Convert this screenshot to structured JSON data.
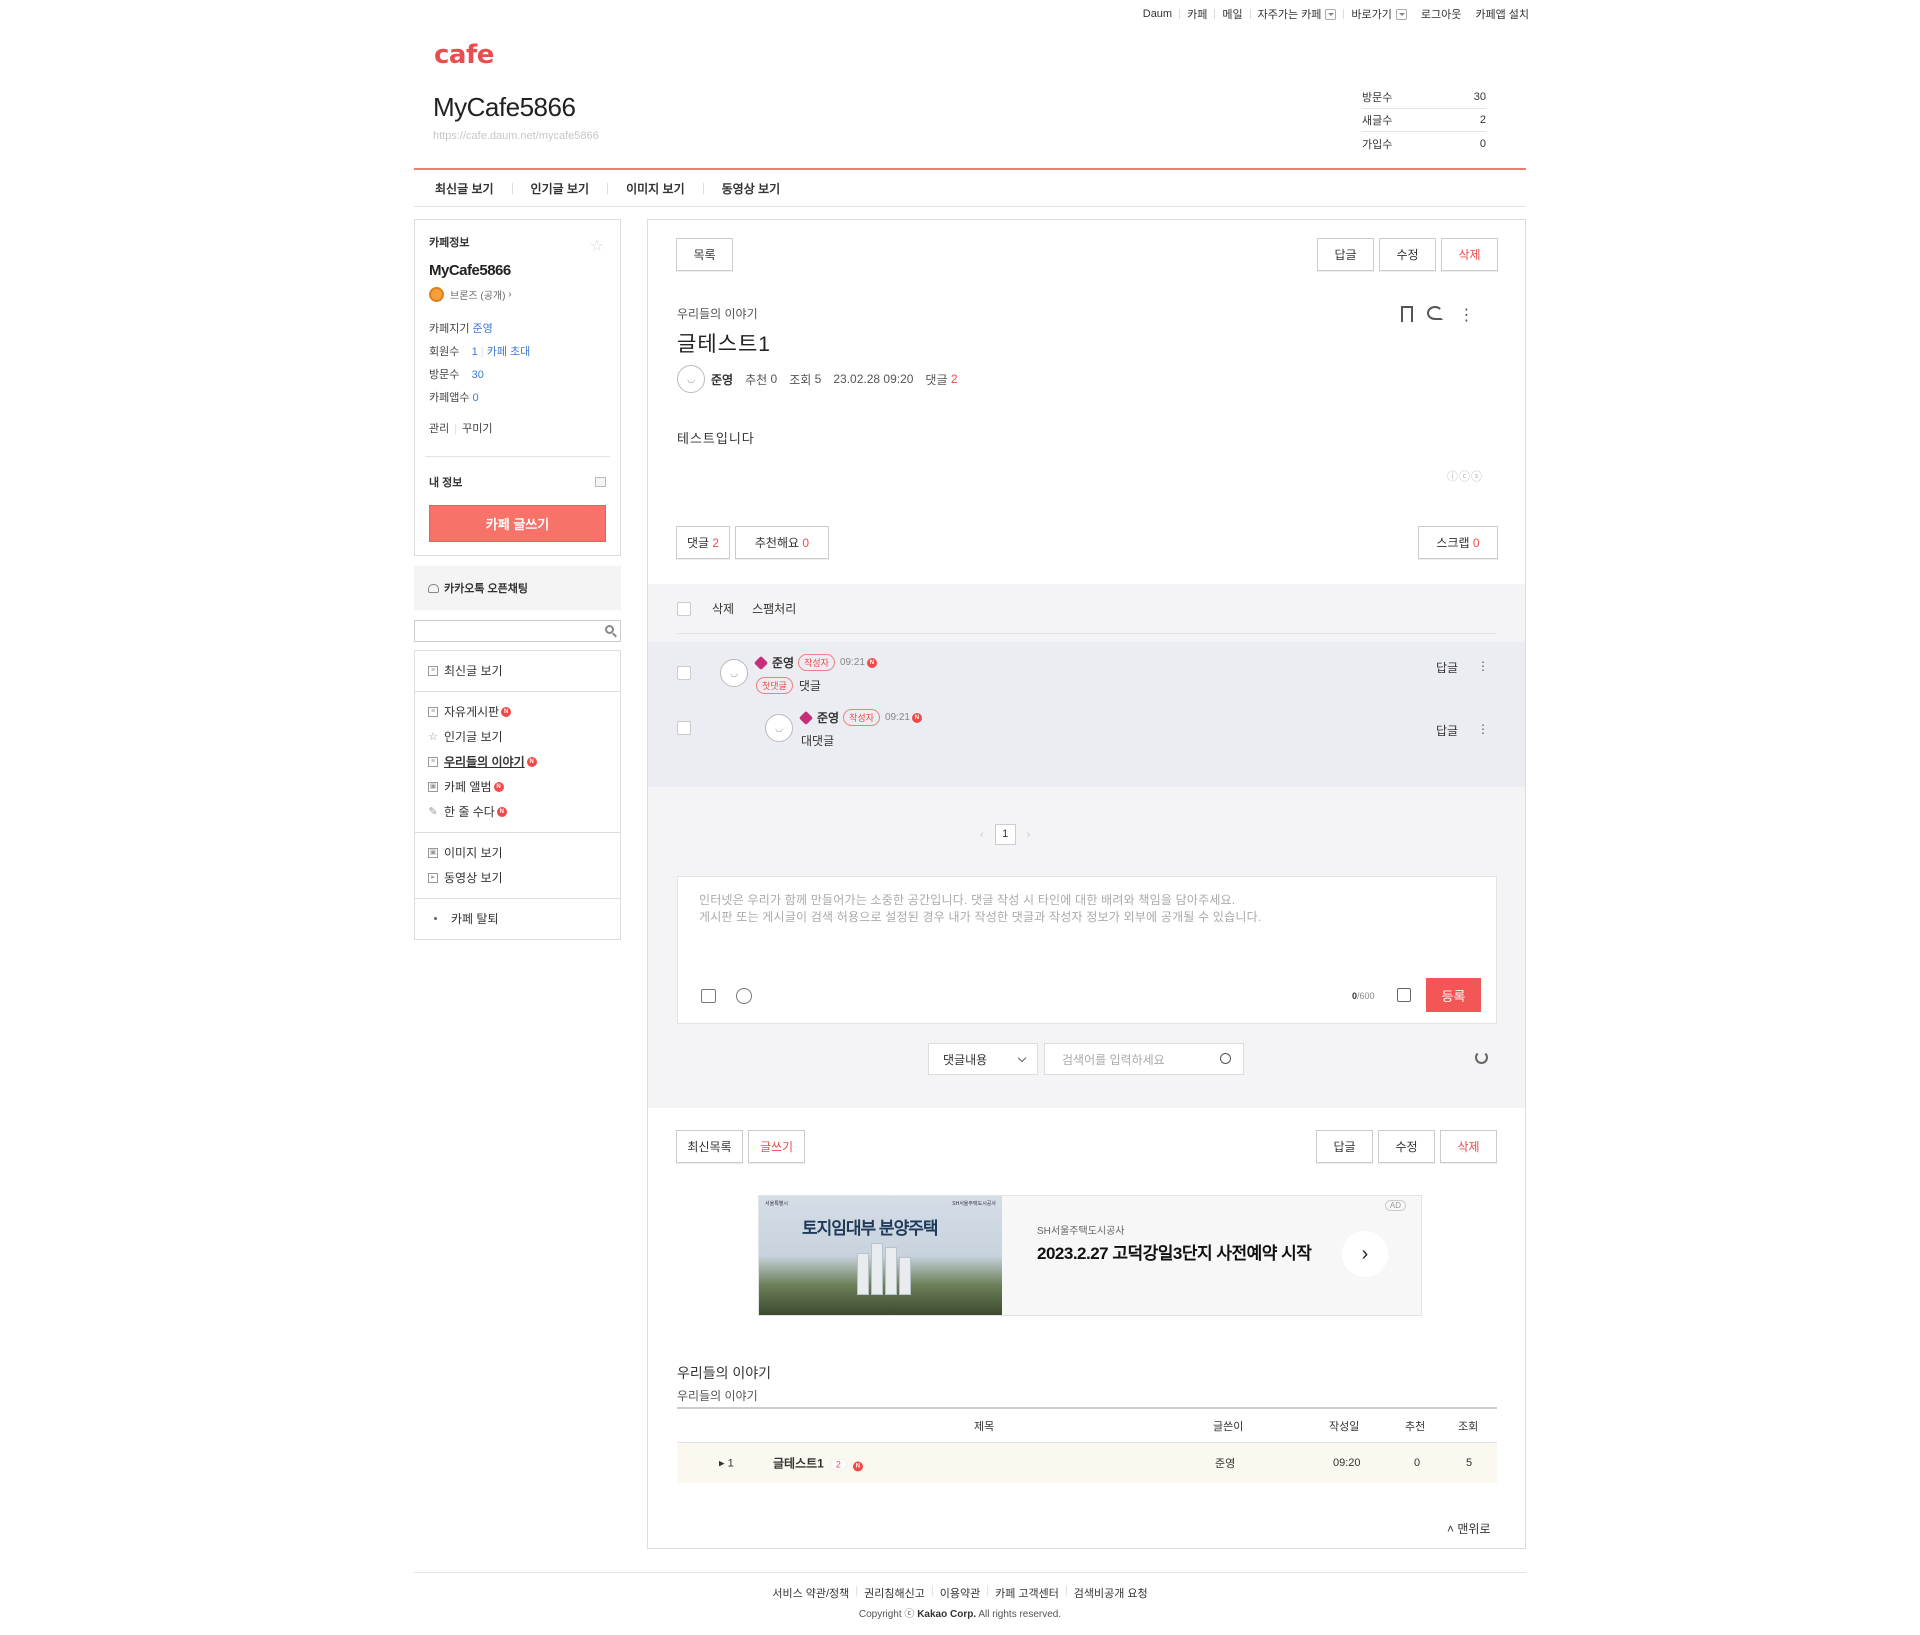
{
  "gnb": {
    "daum": "Daum",
    "cafe": "카페",
    "mail": "메일",
    "fav_cafe": "자주가는 카페",
    "shortcut": "바로가기",
    "logout": "로그아웃",
    "install_app": "카페앱 설치"
  },
  "header": {
    "logo": "cafe",
    "cafe_name": "MyCafe5866",
    "cafe_url": "https://cafe.daum.net/mycafe5866",
    "stats": [
      {
        "label": "방문수",
        "value": "30"
      },
      {
        "label": "새글수",
        "value": "2"
      },
      {
        "label": "가입수",
        "value": "0"
      }
    ]
  },
  "tabs": [
    "최신글 보기",
    "인기글 보기",
    "이미지 보기",
    "동영상 보기"
  ],
  "sidebar": {
    "info_heading": "카페정보",
    "cafe_name": "MyCafe5866",
    "grade": "브론즈 (공개)",
    "manager_label": "카페지기",
    "manager_value": "준영",
    "members_label": "회원수",
    "members_value": "1",
    "invite": "카페 초대",
    "visits_label": "방문수",
    "visits_value": "30",
    "app_label": "카페앱수",
    "app_value": "0",
    "admin": "관리",
    "decorate": "꾸미기",
    "my_info": "내 정보",
    "write_button": "카페 글쓰기",
    "kakao": "카카오톡 오픈채팅",
    "menu_groups": [
      [
        {
          "label": "최신글 보기",
          "icon": "list-icon",
          "new": false
        }
      ],
      [
        {
          "label": "자유게시판",
          "icon": "board-icon",
          "new": true
        },
        {
          "label": "인기글 보기",
          "icon": "star-icon",
          "new": false
        },
        {
          "label": "우리들의 이야기",
          "icon": "board-icon",
          "new": true
        },
        {
          "label": "카페 앨범",
          "icon": "image-icon",
          "new": true
        },
        {
          "label": "한 줄 수다",
          "icon": "pencil-icon",
          "new": true
        }
      ],
      [
        {
          "label": "이미지 보기",
          "icon": "image-icon",
          "new": false
        },
        {
          "label": "동영상 보기",
          "icon": "video-icon",
          "new": false
        }
      ]
    ],
    "leave": "카페 탈퇴",
    "new_badge": "N"
  },
  "post": {
    "list_button": "목록",
    "reply_button": "답글",
    "edit_button": "수정",
    "delete_button": "삭제",
    "board_name": "우리들의 이야기",
    "title": "글테스트1",
    "author": "준영",
    "recommend_label": "추천",
    "recommend_value": "0",
    "views_label": "조회",
    "views_value": "5",
    "date": "23.02.28 09:20",
    "comments_label": "댓글",
    "comments_value": "2",
    "content": "테스트입니다",
    "ccl": "ⓘⓒⓢ",
    "comment_btn_label": "댓글",
    "comment_btn_value": "2",
    "like_btn_label": "추천해요",
    "like_btn_value": "0",
    "scrap_btn_label": "스크랩",
    "scrap_btn_value": "0"
  },
  "comments": {
    "delete": "삭제",
    "spam": "스팸처리",
    "author_tag": "작성자",
    "first_tag": "첫댓글",
    "reply": "답글",
    "items": [
      {
        "nick": "준영",
        "time": "09:21",
        "text": "댓글"
      },
      {
        "nick": "준영",
        "time": "09:21",
        "text": "대댓글"
      }
    ],
    "page": "1",
    "placeholder_line1": "인터넷은 우리가 함께 만들어가는 소중한 공간입니다. 댓글 작성 시 타인에 대한 배려와 책임을 담아주세요.",
    "placeholder_line2": "게시판 또는 게시글이 검색 허용으로 설정된 경우 내가 작성한 댓글과 작성자 정보가 외부에 공개될 수 있습니다.",
    "count_now": "0",
    "count_max": "/600",
    "submit": "등록",
    "search_select": "댓글내용",
    "search_placeholder": "검색어를 입력하세요"
  },
  "bottom_bar": {
    "recent_list": "최신목록",
    "write": "글쓰기",
    "reply": "답글",
    "edit": "수정",
    "delete": "삭제"
  },
  "ad": {
    "image_headline": "토지임대부 분양주택",
    "logo_left": "서울특별시",
    "logo_right": "SH서울주택도시공사",
    "sponsor": "SH서울주택도시공사",
    "headline": "2023.2.27 고덕강일3단지 사전예약 시작",
    "tag": "AD"
  },
  "board_list": {
    "title": "우리들의 이야기",
    "subtitle": "우리들의 이야기",
    "headers": [
      "제목",
      "글쓴이",
      "작성일",
      "추천",
      "조회"
    ],
    "rows": [
      {
        "num": "1",
        "title": "글테스트1",
        "comments": "2",
        "author": "준영",
        "date": "09:20",
        "recommend": "0",
        "views": "5"
      }
    ],
    "to_top": "맨위로"
  },
  "footer": {
    "links": [
      "서비스 약관/정책",
      "권리침해신고",
      "이용약관",
      "카페 고객센터",
      "검색비공개 요청"
    ],
    "copyright_prefix": "Copyright ⓒ",
    "copyright_company": "Kakao Corp.",
    "copyright_suffix": "All rights reserved."
  },
  "colors": {
    "accent": "#e84d50",
    "write_button": "#f7736a",
    "submit": "#f25656",
    "link_blue": "#3f78d1"
  }
}
